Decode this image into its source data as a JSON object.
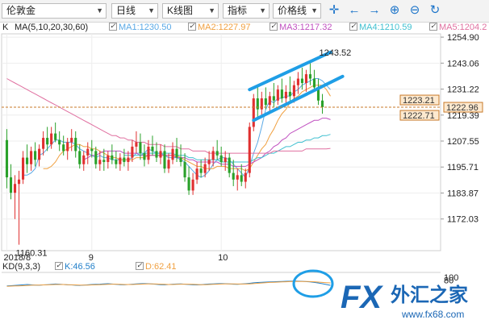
{
  "toolbar": {
    "symbol": "伦敦金",
    "period": "日线",
    "chart_type": "K线图",
    "indicator": "指标",
    "price_line": "价格线",
    "tool_icons": [
      "crosshair-icon",
      "arrow-left-icon",
      "arrow-right-icon",
      "zoom-in-icon",
      "zoom-out-icon",
      "refresh-icon"
    ]
  },
  "legend": {
    "k_label": "K",
    "ma_label": "MA(5,10,20,30,60)",
    "ma1": "MA1:1230.50",
    "ma2": "MA2:1227.97",
    "ma3": "MA3:1217.32",
    "ma4": "MA4:1210.59",
    "ma5": "MA5:1204.2"
  },
  "kd_legend": {
    "label": "KD(9,3,3)",
    "k": "K:46.56",
    "d": "D:62.41"
  },
  "price_tags": {
    "upper": "1223.21",
    "current": "1222.96",
    "lower": "1222.71"
  },
  "colors": {
    "up": "#e03030",
    "down": "#2aa12a",
    "ma1": "#5aa9e6",
    "ma2": "#f0a040",
    "ma3": "#c050c0",
    "ma4": "#40c0d0",
    "ma5": "#e070a0",
    "channel": "#1f9ee6",
    "price_line": "#c87a2a"
  },
  "watermark": {
    "brand": "FX",
    "cn": "外汇之家",
    "url": "www.fx68.com"
  },
  "chart_data": [
    {
      "type": "candlestick",
      "yticks": [
        1254.9,
        1243.06,
        1231.22,
        1219.39,
        1207.55,
        1195.71,
        1183.87,
        1172.03
      ],
      "ytick_labels": [
        "1254.90",
        "1243.06",
        "1231.22",
        "1219.39",
        "1207.55",
        "1195.71",
        "1183.87",
        "1172.03"
      ],
      "ylim": [
        1157.6,
        1256.4
      ],
      "x_labels": [
        {
          "text": "2018/8",
          "index": 0
        },
        {
          "text": "9",
          "index": 21
        },
        {
          "text": "10",
          "index": 53
        }
      ],
      "annotations": [
        {
          "text": "1243.52",
          "index": 78,
          "value": 1243.52
        },
        {
          "text": "1160.31",
          "index": 3,
          "value": 1160.31
        }
      ],
      "current_price": 1222.96,
      "candles": [
        [
          1208,
          1213,
          1186,
          1191
        ],
        [
          1191,
          1197,
          1181,
          1184
        ],
        [
          1184,
          1192,
          1172,
          1188
        ],
        [
          1188,
          1194,
          1160.31,
          1190
        ],
        [
          1190,
          1203,
          1188,
          1200
        ],
        [
          1200,
          1206,
          1193,
          1197
        ],
        [
          1197,
          1205,
          1194,
          1203
        ],
        [
          1203,
          1207,
          1196,
          1199
        ],
        [
          1199,
          1206,
          1196,
          1204
        ],
        [
          1204,
          1212,
          1201,
          1209
        ],
        [
          1209,
          1214,
          1203,
          1206
        ],
        [
          1206,
          1214,
          1204,
          1211
        ],
        [
          1211,
          1216,
          1207,
          1208
        ],
        [
          1208,
          1212,
          1203,
          1206
        ],
        [
          1206,
          1210,
          1201,
          1203
        ],
        [
          1203,
          1209,
          1199,
          1207
        ],
        [
          1207,
          1213,
          1203,
          1209
        ],
        [
          1209,
          1212,
          1200,
          1203
        ],
        [
          1203,
          1206,
          1195,
          1197
        ],
        [
          1197,
          1203,
          1194,
          1201
        ],
        [
          1201,
          1207,
          1197,
          1204
        ],
        [
          1204,
          1208,
          1200,
          1203
        ],
        [
          1203,
          1205,
          1195,
          1197
        ],
        [
          1197,
          1203,
          1194,
          1199
        ],
        [
          1199,
          1204,
          1194,
          1198
        ],
        [
          1198,
          1203,
          1195,
          1201
        ],
        [
          1201,
          1206,
          1197,
          1199
        ],
        [
          1199,
          1203,
          1195,
          1197
        ],
        [
          1197,
          1202,
          1194,
          1200
        ],
        [
          1200,
          1204,
          1196,
          1198
        ],
        [
          1198,
          1203,
          1194,
          1200
        ],
        [
          1200,
          1208,
          1198,
          1205
        ],
        [
          1205,
          1212,
          1202,
          1207
        ],
        [
          1207,
          1211,
          1199,
          1202
        ],
        [
          1202,
          1206,
          1196,
          1199
        ],
        [
          1199,
          1208,
          1197,
          1205
        ],
        [
          1205,
          1210,
          1201,
          1203
        ],
        [
          1203,
          1207,
          1198,
          1200
        ],
        [
          1200,
          1206,
          1197,
          1203
        ],
        [
          1203,
          1206,
          1193,
          1195
        ],
        [
          1195,
          1202,
          1193,
          1199
        ],
        [
          1199,
          1207,
          1197,
          1204
        ],
        [
          1204,
          1209,
          1198,
          1200
        ],
        [
          1200,
          1206,
          1196,
          1198
        ],
        [
          1198,
          1202,
          1189,
          1191
        ],
        [
          1191,
          1196,
          1183,
          1185
        ],
        [
          1185,
          1193,
          1183,
          1190
        ],
        [
          1190,
          1198,
          1188,
          1195
        ],
        [
          1195,
          1199,
          1191,
          1193
        ],
        [
          1193,
          1200,
          1191,
          1197
        ],
        [
          1197,
          1203,
          1194,
          1199
        ],
        [
          1199,
          1205,
          1196,
          1203
        ],
        [
          1203,
          1208,
          1199,
          1201
        ],
        [
          1201,
          1205,
          1196,
          1198
        ],
        [
          1198,
          1203,
          1194,
          1200
        ],
        [
          1200,
          1202,
          1191,
          1193
        ],
        [
          1193,
          1199,
          1187,
          1190
        ],
        [
          1190,
          1195,
          1185,
          1192
        ],
        [
          1192,
          1197,
          1187,
          1189
        ],
        [
          1189,
          1195,
          1186,
          1193
        ],
        [
          1193,
          1216,
          1191,
          1214
        ],
        [
          1214,
          1229,
          1212,
          1227
        ],
        [
          1227,
          1233,
          1218,
          1222
        ],
        [
          1222,
          1230,
          1219,
          1227
        ],
        [
          1227,
          1232,
          1222,
          1224
        ],
        [
          1224,
          1230,
          1221,
          1228
        ],
        [
          1228,
          1234,
          1223,
          1226
        ],
        [
          1226,
          1233,
          1224,
          1231
        ],
        [
          1231,
          1236,
          1225,
          1227
        ],
        [
          1227,
          1233,
          1224,
          1230
        ],
        [
          1230,
          1237,
          1226,
          1228
        ],
        [
          1228,
          1235,
          1225,
          1233
        ],
        [
          1233,
          1239,
          1229,
          1236
        ],
        [
          1236,
          1241,
          1231,
          1234
        ],
        [
          1234,
          1240,
          1230,
          1238
        ],
        [
          1238,
          1243.52,
          1233,
          1236
        ],
        [
          1236,
          1240,
          1230,
          1232
        ],
        [
          1232,
          1236,
          1224,
          1226
        ],
        [
          1226,
          1229,
          1220,
          1222.96
        ]
      ],
      "ma_series": [
        {
          "name": "MA1",
          "values": [
            null,
            null,
            null,
            null,
            1192,
            1192,
            1193,
            1195,
            1201,
            1202,
            1204,
            1206,
            1208,
            1208,
            1207,
            1207,
            1207,
            1206,
            1204,
            1203,
            1202,
            1201,
            1200,
            1201,
            1200,
            1200,
            1199,
            1199,
            1199,
            1199,
            1199,
            1200,
            1202,
            1202,
            1202,
            1204,
            1203,
            1202,
            1202,
            1201,
            1200,
            1200,
            1200,
            1199,
            1198,
            1196,
            1194,
            1192,
            1191,
            1192,
            1194,
            1197,
            1199,
            1200,
            1200,
            1199,
            1197,
            1195,
            1193,
            1191,
            1196,
            1202,
            1207,
            1214,
            1222,
            1226,
            1225,
            1227,
            1227,
            1228,
            1228,
            1230,
            1231,
            1233,
            1234,
            1235,
            1236,
            1236,
            1235,
            1233,
            1231
          ]
        },
        {
          "name": "MA2",
          "values": [
            null,
            null,
            null,
            null,
            null,
            null,
            null,
            null,
            null,
            1195,
            1195,
            1196,
            1198,
            1201,
            1203,
            1204,
            1205,
            1206,
            1206,
            1205,
            1205,
            1204,
            1204,
            1203,
            1202,
            1201,
            1200,
            1200,
            1199,
            1199,
            1199,
            1199,
            1200,
            1200,
            1200,
            1201,
            1201,
            1201,
            1201,
            1201,
            1201,
            1201,
            1201,
            1200,
            1199,
            1198,
            1197,
            1196,
            1196,
            1195,
            1195,
            1195,
            1196,
            1196,
            1196,
            1195,
            1195,
            1195,
            1195,
            1194,
            1195,
            1198,
            1201,
            1204,
            1206,
            1210,
            1213,
            1217,
            1220,
            1222,
            1225,
            1227,
            1228,
            1230,
            1231,
            1232,
            1233,
            1233,
            1233,
            1231,
            1228
          ]
        },
        {
          "name": "MA3",
          "values": [
            null,
            null,
            null,
            null,
            null,
            null,
            null,
            null,
            null,
            null,
            null,
            null,
            null,
            null,
            null,
            null,
            null,
            null,
            null,
            1199,
            1200,
            1201,
            1201,
            1202,
            1203,
            1203,
            1203,
            1203,
            1203,
            1202,
            1202,
            1202,
            1202,
            1201,
            1201,
            1201,
            1201,
            1201,
            1201,
            1201,
            1201,
            1201,
            1200,
            1200,
            1200,
            1199,
            1199,
            1198,
            1198,
            1198,
            1198,
            1198,
            1198,
            1197,
            1197,
            1197,
            1196,
            1196,
            1196,
            1196,
            1197,
            1198,
            1199,
            1200,
            1202,
            1203,
            1205,
            1206,
            1208,
            1209,
            1211,
            1212,
            1213,
            1214,
            1215,
            1216,
            1217,
            1217,
            1218,
            1218,
            1217.32
          ]
        },
        {
          "name": "MA4",
          "values": [
            null,
            null,
            null,
            null,
            null,
            null,
            null,
            null,
            null,
            null,
            null,
            null,
            null,
            null,
            null,
            null,
            null,
            null,
            null,
            null,
            null,
            null,
            null,
            null,
            null,
            null,
            null,
            null,
            null,
            1201,
            1201,
            1201,
            1201,
            1201,
            1202,
            1202,
            1202,
            1202,
            1202,
            1202,
            1202,
            1202,
            1201,
            1201,
            1201,
            1200,
            1200,
            1199,
            1199,
            1199,
            1199,
            1199,
            1199,
            1198,
            1198,
            1198,
            1198,
            1198,
            1198,
            1198,
            1198,
            1199,
            1200,
            1200,
            1201,
            1202,
            1202,
            1203,
            1204,
            1205,
            1205,
            1206,
            1207,
            1207,
            1208,
            1208,
            1209,
            1209,
            1210,
            1210,
            1210.59
          ]
        },
        {
          "name": "MA5",
          "values": [
            1236,
            1235,
            1234,
            1233,
            1232,
            1231,
            1230,
            1229,
            1228,
            1227,
            1226,
            1225,
            1224,
            1223,
            1222,
            1221,
            1220,
            1219,
            1218,
            1217,
            1216,
            1215,
            1214,
            1213,
            1212,
            1211,
            1210,
            1210,
            1209,
            1209,
            1208,
            1208,
            1207,
            1207,
            1207,
            1206,
            1206,
            1206,
            1206,
            1205,
            1205,
            1205,
            1205,
            1204,
            1204,
            1204,
            1203,
            1203,
            1203,
            1203,
            1202,
            1202,
            1202,
            1202,
            1202,
            1202,
            1202,
            1202,
            1202,
            1202,
            1202,
            1202,
            1202,
            1202,
            1202,
            1202,
            1203,
            1203,
            1203,
            1203,
            1203,
            1203,
            1203,
            1203,
            1204,
            1204,
            1204,
            1204,
            1204,
            1204,
            1204.2
          ]
        }
      ],
      "channel": [
        {
          "from": {
            "index": 60,
            "value": 1231
          },
          "to": {
            "index": 80,
            "value": 1248
          }
        },
        {
          "from": {
            "index": 61,
            "value": 1217
          },
          "to": {
            "index": 83,
            "value": 1237
          }
        }
      ]
    },
    {
      "type": "line",
      "title": "KD(9,3,3)",
      "yticks": [
        100,
        80
      ],
      "ylim": [
        0,
        100
      ],
      "series": [
        {
          "name": "K",
          "values": [
            42,
            44,
            46,
            48,
            50,
            52,
            50,
            48,
            47,
            49,
            51,
            53,
            55,
            54,
            52,
            50,
            49,
            47,
            46,
            48,
            50,
            52,
            53,
            54,
            56,
            57,
            55,
            53,
            51,
            50,
            52,
            54,
            56,
            57,
            58,
            57,
            55,
            53,
            51,
            50,
            52,
            54,
            55,
            56,
            54,
            52,
            50,
            49,
            51,
            53,
            55,
            56,
            57,
            58,
            57,
            56,
            54,
            53,
            55,
            57,
            60,
            63,
            65,
            67,
            68,
            69,
            70,
            71,
            72,
            73,
            74,
            75,
            74,
            73,
            71,
            69,
            66,
            62,
            57,
            52,
            46.56
          ]
        },
        {
          "name": "D",
          "values": [
            40,
            41,
            42,
            43,
            44,
            45,
            47,
            48,
            48,
            49,
            50,
            51,
            52,
            52,
            52,
            51,
            50,
            49,
            48,
            48,
            48,
            49,
            50,
            51,
            52,
            53,
            54,
            54,
            53,
            52,
            52,
            52,
            53,
            54,
            55,
            56,
            56,
            55,
            54,
            53,
            52,
            52,
            53,
            54,
            54,
            54,
            53,
            52,
            51,
            51,
            52,
            53,
            54,
            55,
            56,
            56,
            56,
            55,
            55,
            55,
            56,
            58,
            60,
            62,
            64,
            66,
            67,
            68,
            69,
            70,
            71,
            72,
            72,
            72,
            72,
            71,
            70,
            68,
            66,
            64,
            62.41
          ]
        }
      ]
    }
  ]
}
